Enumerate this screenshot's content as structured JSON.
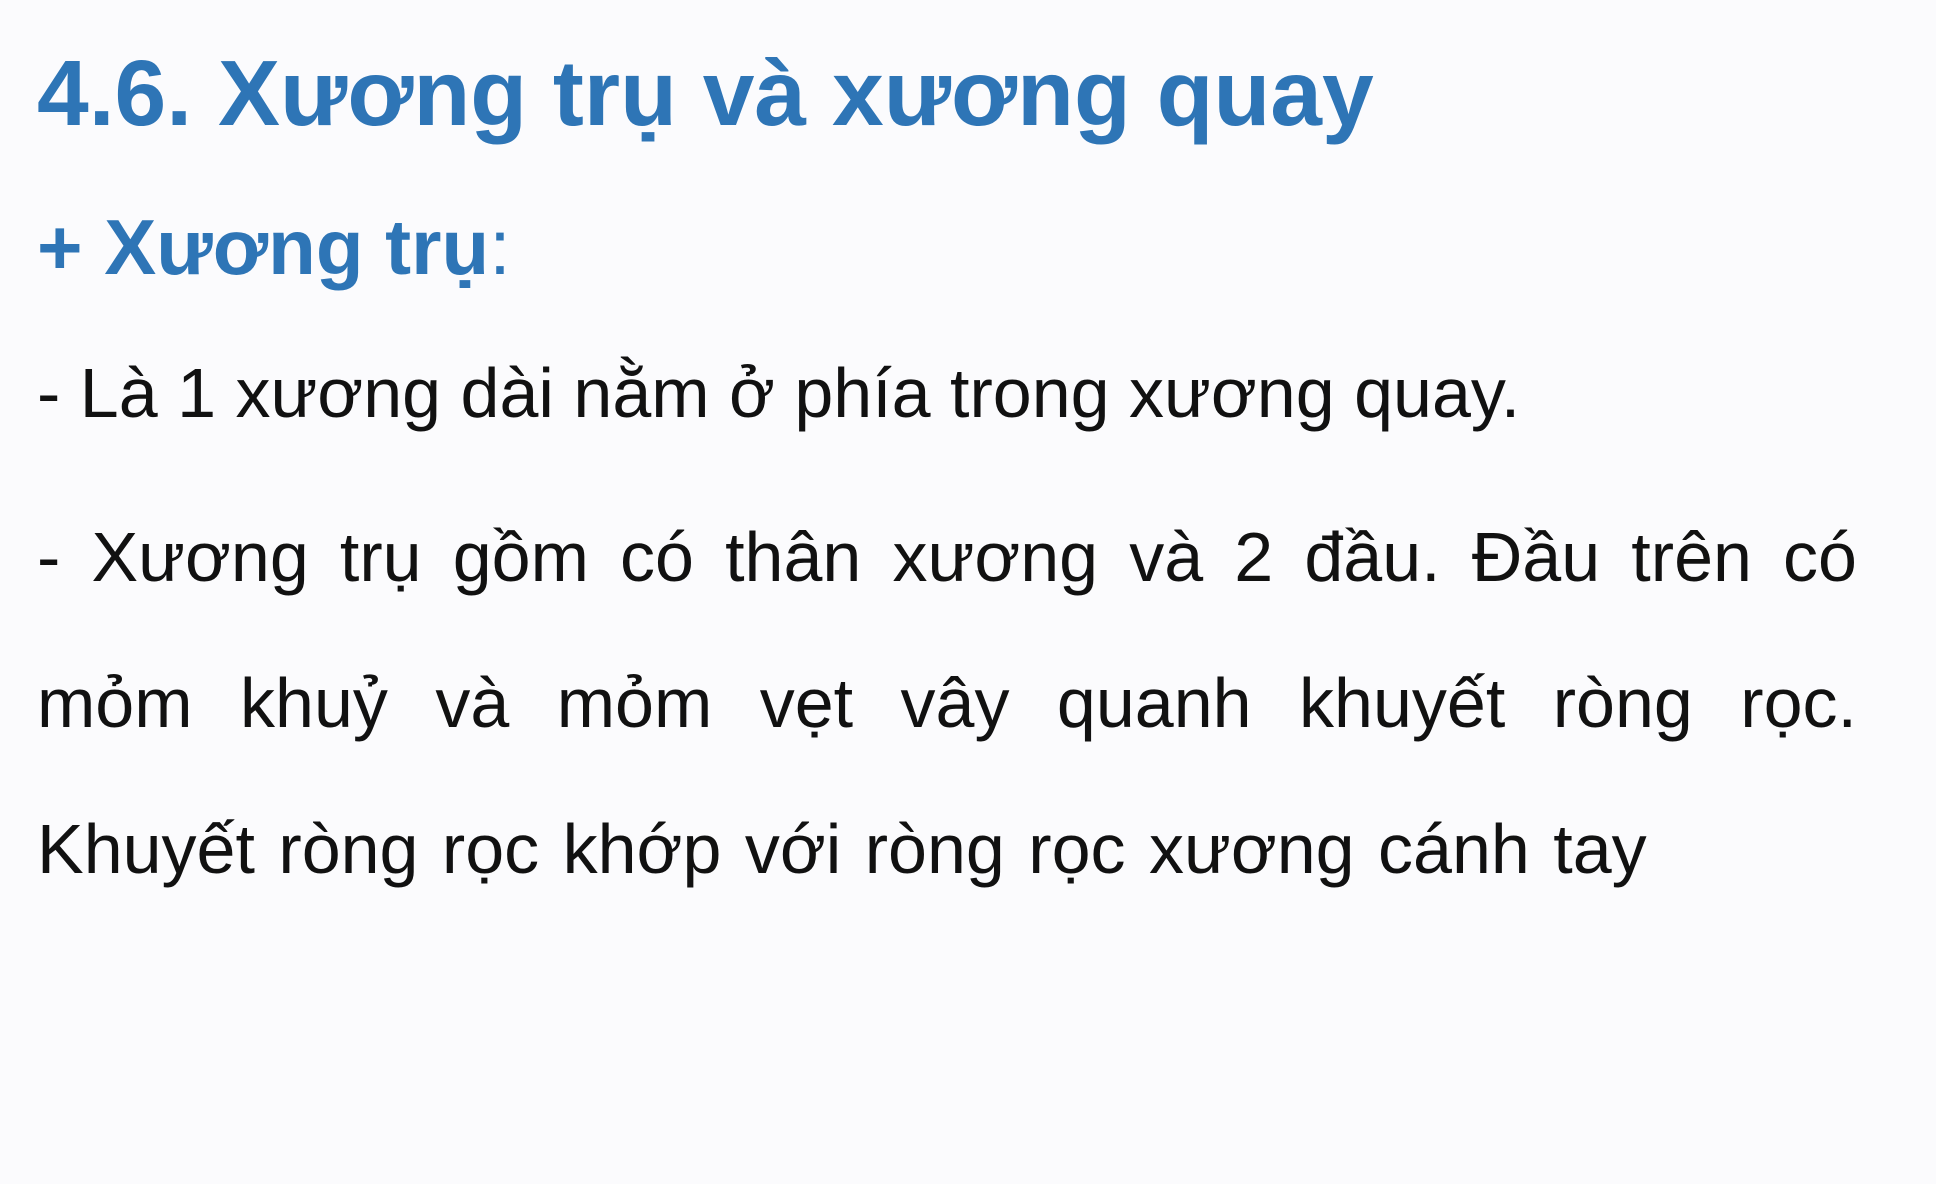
{
  "heading": "4.6. Xương trụ và xương quay",
  "subheading": {
    "prefix": "+ Xương trụ",
    "colon": ":"
  },
  "paragraphs": [
    "- Là 1 xương dài nằm ở phía trong xương quay.",
    "- Xương trụ gồm có thân xương và 2 đầu. Đầu trên có mỏm khuỷ và mỏm vẹt vây quanh khuyết ròng rọc. Khuyết ròng rọc khớp với ròng rọc xương cánh tay"
  ],
  "colors": {
    "heading": "#2e75b6",
    "body_text": "#111111",
    "background": "#fbfbfd"
  }
}
